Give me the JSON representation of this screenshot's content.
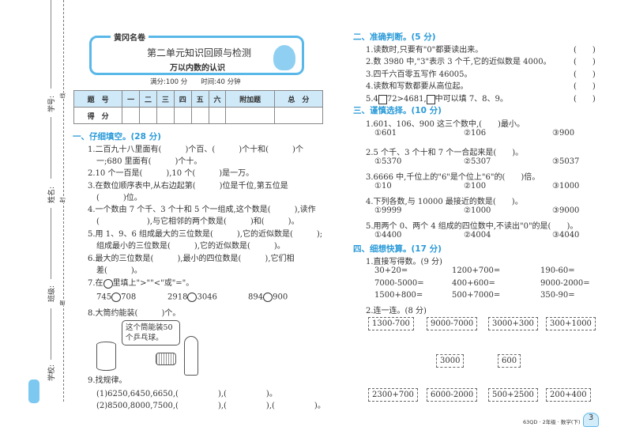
{
  "binding": {
    "student_no": "学号:",
    "name": "姓名:",
    "class": "班级:",
    "school": "学校:",
    "seal_line": [
      "线",
      "封",
      "密"
    ]
  },
  "header": {
    "logo": "黄冈名卷",
    "title": "第二单元知识回顾与检测",
    "subtitle": "万以内数的认识",
    "meta": "满分:100 分　　时间:40 分钟"
  },
  "score_table": {
    "row1": [
      "题　号",
      "一",
      "二",
      "三",
      "四",
      "五",
      "六",
      "附加题",
      "总　分"
    ],
    "row2": [
      "得　分"
    ]
  },
  "s1": {
    "heading": "一、仔细填空。(28 分)",
    "lines": [
      "1.二百九十八里面有(　　　)个百、(　　　)个十和(　　　)个",
      "一;680 里面有(　　　)个十。",
      "2.10 个一百是(　　　),10 个(　　　)是一万。",
      "3.在数位顺序表中,从右边起第(　　　)位是千位,第五位是",
      "(　　　)位。",
      "4.一个数由 7 个千、3 个十和 5 个一组成,这个数是(　　　),读作",
      "(　　　　　　),与它相邻的两个数是(　　　)和(　　　)。",
      "5.用 1、9、6 组成最大的三位数是(　　　),它的近似数是(　　　);",
      "组成最小的三位数是(　　　),它的近似数是(　　　)。",
      "6.最大的三位数是(　　　),最小的四位数是(　　　),它们相",
      "差(　　　)。"
    ],
    "q7_pre": "7.在",
    "q7_post": "里填上\">\"\"<\"或\"=\"。",
    "q7_items": [
      [
        "745",
        "708"
      ],
      [
        "2918",
        "3046"
      ],
      [
        "894",
        "900"
      ]
    ],
    "q8": "8.大筒约能装(　　　)个。",
    "q8_bubble": "这个筒能装50个乒乓球。",
    "q9": "9.找规律。",
    "q9_1": "(1)6250,6450,6650,(　　　　　),(　　　　　)。",
    "q9_2": "(2)8500,8000,7500,(　　　　　),(　　　　　),(　　　　　)。"
  },
  "s2": {
    "heading": "二、准确判断。(5 分)",
    "items": [
      "1.读数时,只要有\"0\"都要读出来。",
      "2.数 3980 中,\"3\"表示 3 个千,它的近似数是 4000。",
      "3.四千六百零五写作 46005。",
      "4.读数和写数都要从高位起。"
    ],
    "q5a": "5.4",
    "q5b": "72>4681,",
    "q5c": "中可以填 7、8、9。",
    "paren": "(　　)"
  },
  "s3": {
    "heading": "三、谨慎选择。(10 分)",
    "questions": [
      {
        "q": "1.601、106、900 这三个数中,(　　)最小。",
        "opts": [
          "①601",
          "②106",
          "③900"
        ]
      },
      {
        "q": "2.5 个千、3 个十和 7 个一合起来是(　　)。",
        "opts": [
          "①5370",
          "②5307",
          "③5037"
        ]
      },
      {
        "q": "3.6666 中,千位上的\"6\"是个位上\"6\"的(　　)倍。",
        "opts": [
          "①10",
          "②100",
          "③1000"
        ]
      },
      {
        "q": "4.下列各数,与 10000 最接近的数是(　　)。",
        "opts": [
          "①9999",
          "②1000",
          "③9000"
        ]
      },
      {
        "q": "5.用两个 0、两个 4 组成的四位数中,不读出\"0\"的是(　　)。",
        "opts": [
          "①4400",
          "②4004",
          "③4040"
        ]
      }
    ]
  },
  "s4": {
    "heading": "四、细想快算。(17 分)",
    "q1": "1.直接写得数。(9 分)",
    "calc": [
      [
        "30+20=",
        "1200+700=",
        "190-60="
      ],
      [
        "7000-5000=",
        "400+600=",
        "9000-2000="
      ],
      [
        "1500+800=",
        "500+7000=",
        "350-90="
      ]
    ],
    "q2": "2.连一连。(8 分)",
    "top": [
      "1300-700",
      "9000-7000",
      "3000+300",
      "300+1000"
    ],
    "mid": [
      "3000",
      "600"
    ],
    "bottom": [
      "2300+700",
      "6000-2000",
      "500+2500",
      "200+400"
    ]
  },
  "footer": {
    "text": "63QD · 2年级 · 数学(下)",
    "page": "3"
  }
}
